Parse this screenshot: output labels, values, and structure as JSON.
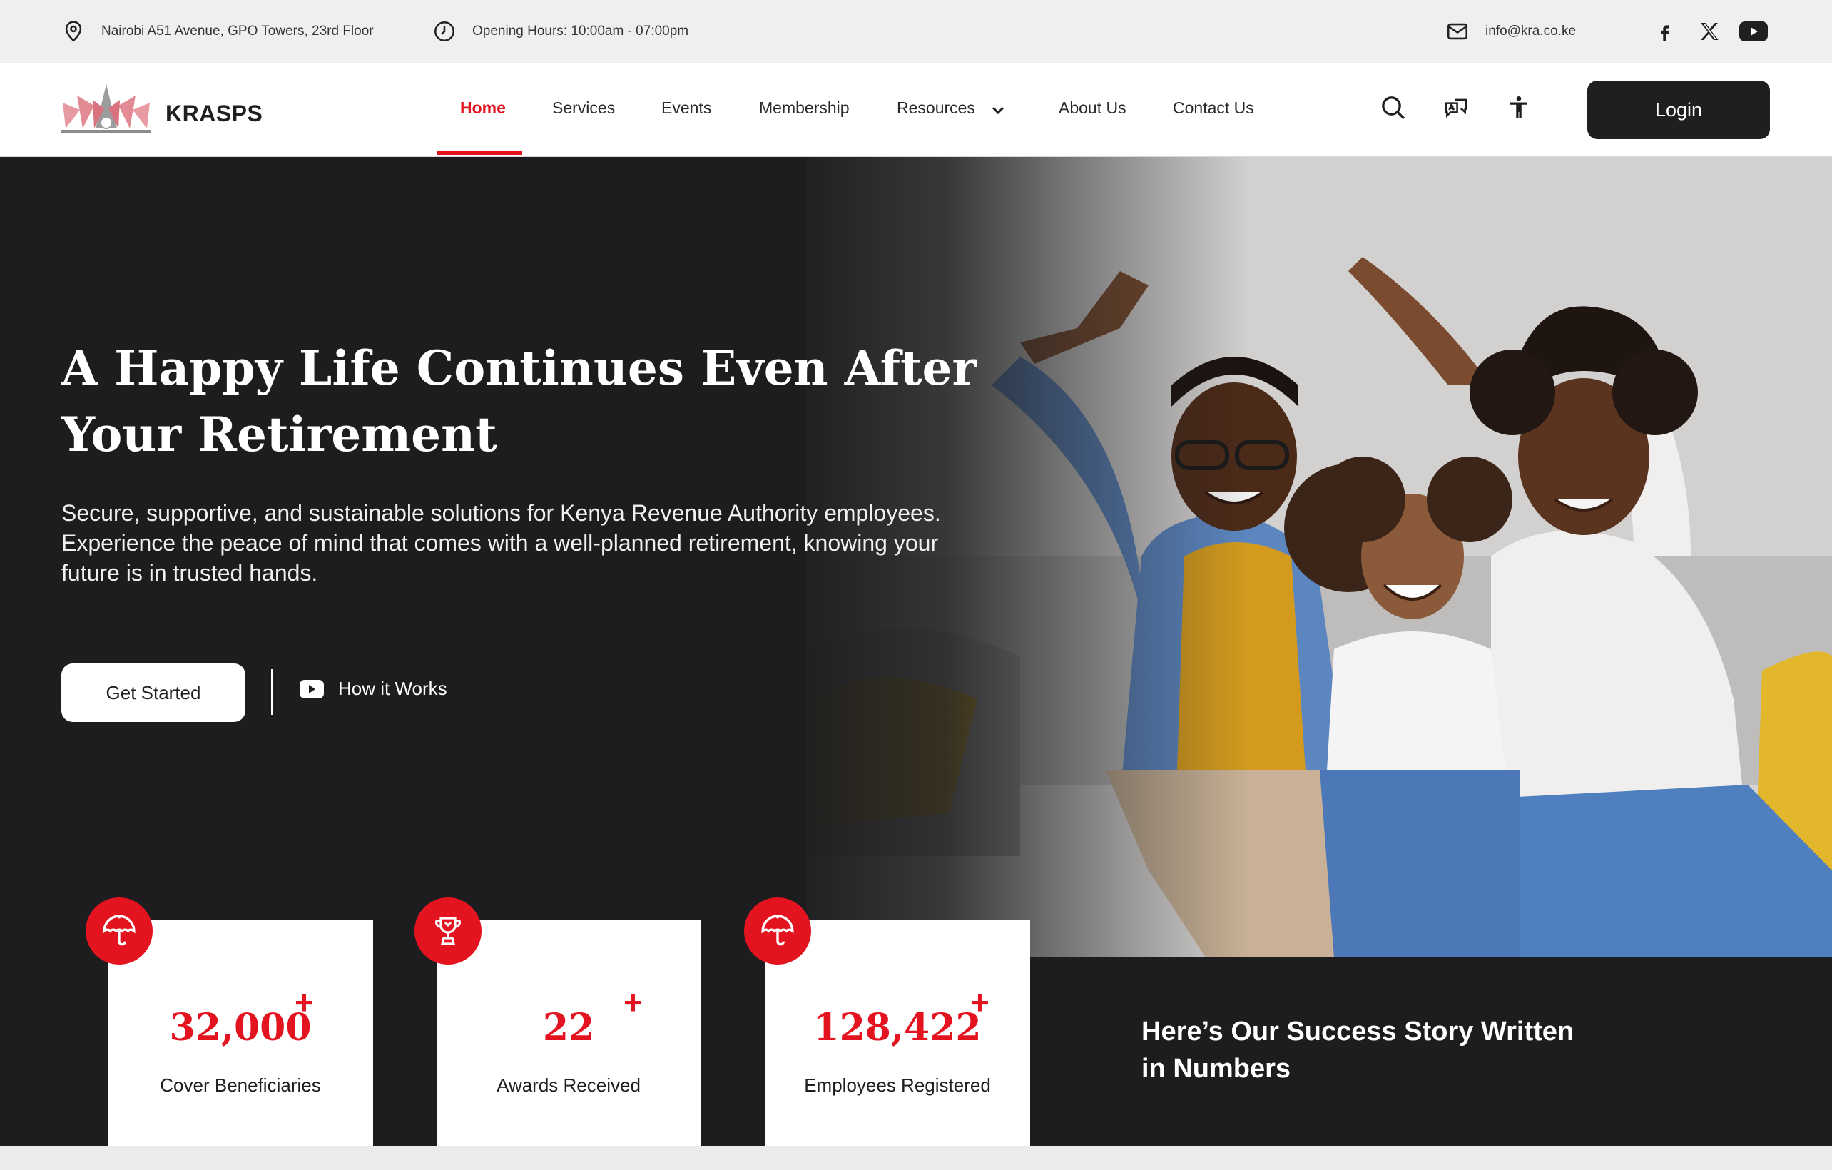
{
  "topbar": {
    "address": "Nairobi A51 Avenue, GPO Towers, 23rd Floor",
    "hours": "Opening Hours: 10:00am - 07:00pm",
    "email": "info@kra.co.ke",
    "icons": [
      "location-icon",
      "clock-icon",
      "mail-icon",
      "facebook-icon",
      "x-icon",
      "youtube-icon"
    ]
  },
  "brand": {
    "name": "KRASPS"
  },
  "nav": {
    "items": [
      "Home",
      "Services",
      "Events",
      "Membership",
      "Resources",
      "About Us",
      "Contact Us"
    ],
    "active": "Home",
    "login": "Login",
    "icons": [
      "search-icon",
      "translate-icon",
      "accessibility-icon",
      "chevron-down-icon"
    ]
  },
  "hero": {
    "title_line1": "A Happy Life Continues Even After",
    "title_line2": "Your Retirement",
    "subtitle_line1": "Secure, supportive, and sustainable solutions for Kenya Revenue Authority employees.",
    "subtitle_line2": "Experience the peace of mind that comes with a well-planned retirement, knowing your",
    "subtitle_line3": "future is in trusted hands.",
    "cta": "Get Started",
    "secondary": "How it Works"
  },
  "stats": [
    {
      "value": "32,000",
      "suffix": "+",
      "label": "Cover Beneficiaries",
      "icon": "umbrella-icon"
    },
    {
      "value": "22",
      "suffix": "+",
      "label": "Awards Received",
      "icon": "trophy-icon"
    },
    {
      "value": "128,422",
      "suffix": "+",
      "label": "Employees Registered",
      "icon": "umbrella-icon"
    }
  ],
  "story": {
    "line1": "Here’s Our Success Story Written",
    "line2": "in Numbers"
  },
  "colors": {
    "accent": "#e3141f",
    "dark": "#1d1d1f",
    "topbar": "#efefef"
  }
}
